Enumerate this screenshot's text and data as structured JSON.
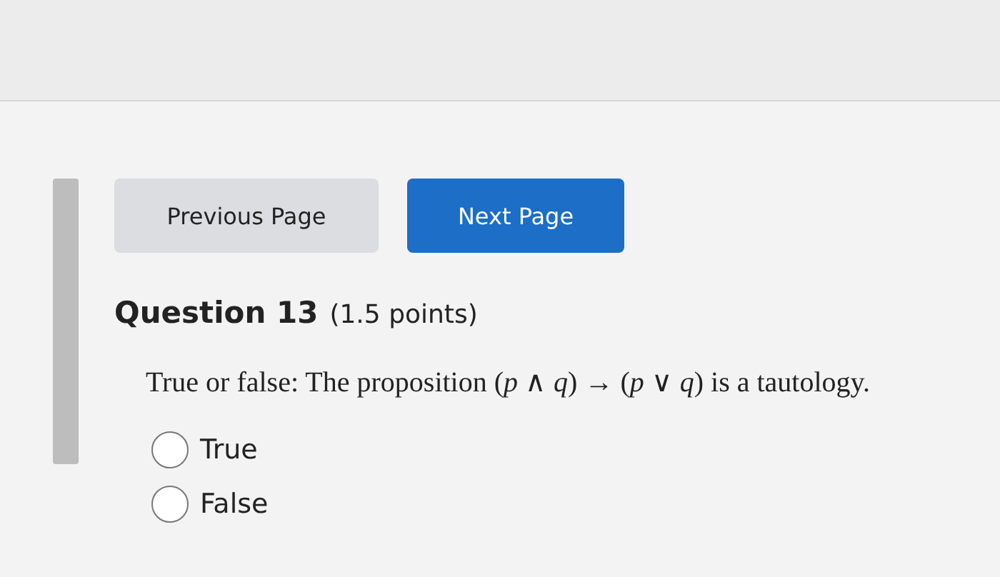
{
  "nav_buttons": [
    {
      "label": "Previous Page",
      "kind": "secondary"
    },
    {
      "label": "Next Page",
      "kind": "primary"
    }
  ],
  "question": {
    "title": "Question 13",
    "points": "(1.5 points)",
    "text": "True or false:  The proposition (*p* ∧ *q*) → (*p* ∨ *q*) is a tautology.",
    "options": [
      {
        "label": "True",
        "selected": false
      },
      {
        "label": "False",
        "selected": false
      }
    ]
  }
}
